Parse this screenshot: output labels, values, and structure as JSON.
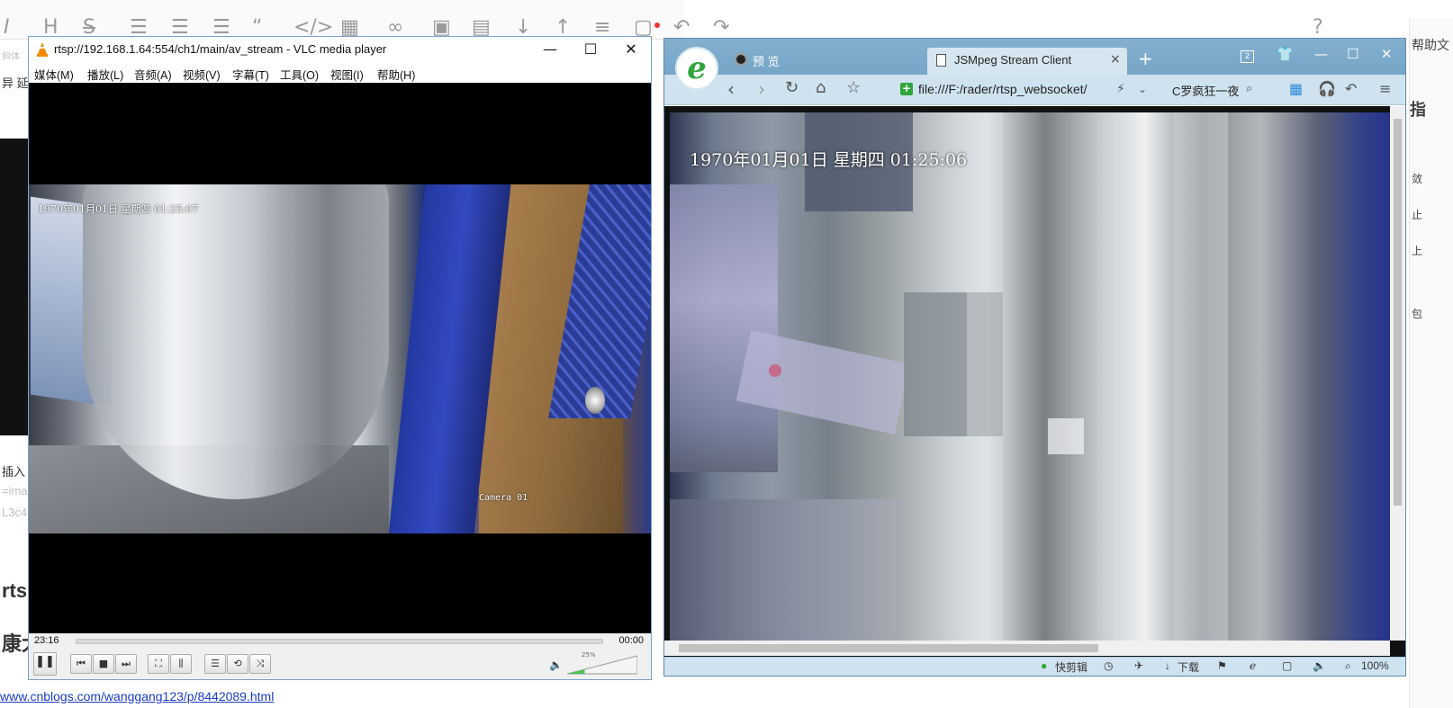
{
  "editor": {
    "left_texts": [
      "斜体",
      "异 延时",
      "插入",
      "=ima",
      "L3c4",
      "rtsp",
      "康大"
    ],
    "link": "www.cnblogs.com/wanggang123/p/8442089.html",
    "right_chars": [
      "帮助文",
      "指",
      "敛",
      "止",
      "上",
      "包"
    ]
  },
  "vlc": {
    "title": "rtsp://192.168.1.64:554/ch1/main/av_stream - VLC media player",
    "menu": [
      "媒体(M)",
      "播放(L)",
      "音频(A)",
      "视频(V)",
      "字幕(T)",
      "工具(O)",
      "视图(I)",
      "帮助(H)"
    ],
    "osd_time": "1970年01月01日  星期四  01:25:07",
    "osd_camera": "Camera 01",
    "time_elapsed": "23:16",
    "time_total": "00:00",
    "volume": "25%",
    "volume_fraction": 0.25,
    "window_buttons": [
      "—",
      "☐",
      "✕"
    ]
  },
  "browser": {
    "logo_letter": "e",
    "tab1_label": "预 览",
    "tab2_label": "JSMpeg Stream Client",
    "tab_close": "×",
    "new_tab": "+",
    "window_count": "2",
    "address": "file:///F:/rader/rtsp_websocket/",
    "search_text": "C罗疯狂一夜",
    "osd_time": "1970年01月01日  星期四  01:25:06",
    "status": {
      "quick_cut": "快剪辑",
      "download": "下载",
      "zoom": "100%"
    }
  },
  "colors": {
    "browser_titlebar": "#7eaccc",
    "browser_navbar": "#cfe2ef",
    "vlc_border": "#7aa0cc",
    "browser_logo_green": "#2ea63b"
  }
}
